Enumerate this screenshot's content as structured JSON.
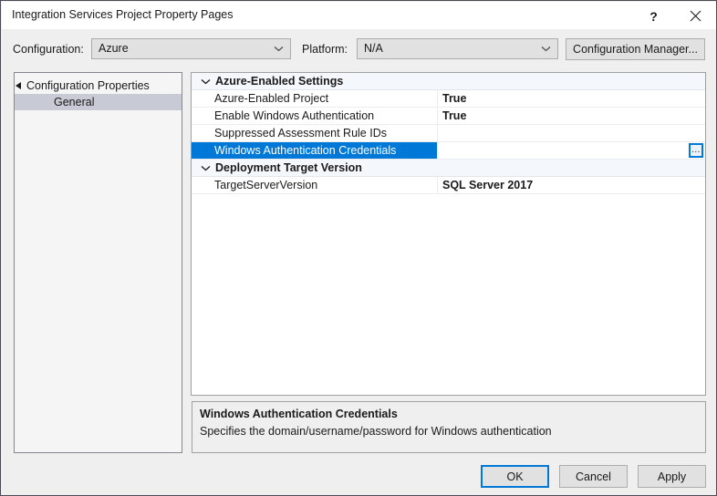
{
  "window": {
    "title": "Integration Services Project Property Pages",
    "help_label": "?",
    "close_label": "✕"
  },
  "toolbar": {
    "configuration_label": "Configuration:",
    "configuration_value": "Azure",
    "platform_label": "Platform:",
    "platform_value": "N/A",
    "configuration_manager_label": "Configuration Manager..."
  },
  "tree": {
    "root_label": "Configuration Properties",
    "child_label": "General"
  },
  "grid": {
    "categories": [
      {
        "name": "Azure-Enabled Settings",
        "properties": [
          {
            "name": "Azure-Enabled Project",
            "value": "True",
            "selected": false,
            "browse": false
          },
          {
            "name": "Enable Windows Authentication",
            "value": "True",
            "selected": false,
            "browse": false
          },
          {
            "name": "Suppressed Assessment Rule IDs",
            "value": "",
            "selected": false,
            "browse": false
          },
          {
            "name": "Windows Authentication Credentials",
            "value": "",
            "selected": true,
            "browse": true
          }
        ]
      },
      {
        "name": "Deployment Target Version",
        "properties": [
          {
            "name": "TargetServerVersion",
            "value": "SQL Server 2017",
            "selected": false,
            "browse": false
          }
        ]
      }
    ],
    "browse_button_label": "…"
  },
  "description": {
    "title": "Windows Authentication Credentials",
    "text": "Specifies the domain/username/password for Windows authentication"
  },
  "footer": {
    "ok_label": "OK",
    "cancel_label": "Cancel",
    "apply_label": "Apply"
  },
  "colors": {
    "accent": "#0078d7",
    "dialog_bg": "#efefef",
    "titlebar_bg": "#ffffff",
    "grid_bg": "#ffffff",
    "category_bg": "#f4f7fb",
    "tree_selection": "#c8cad5"
  }
}
